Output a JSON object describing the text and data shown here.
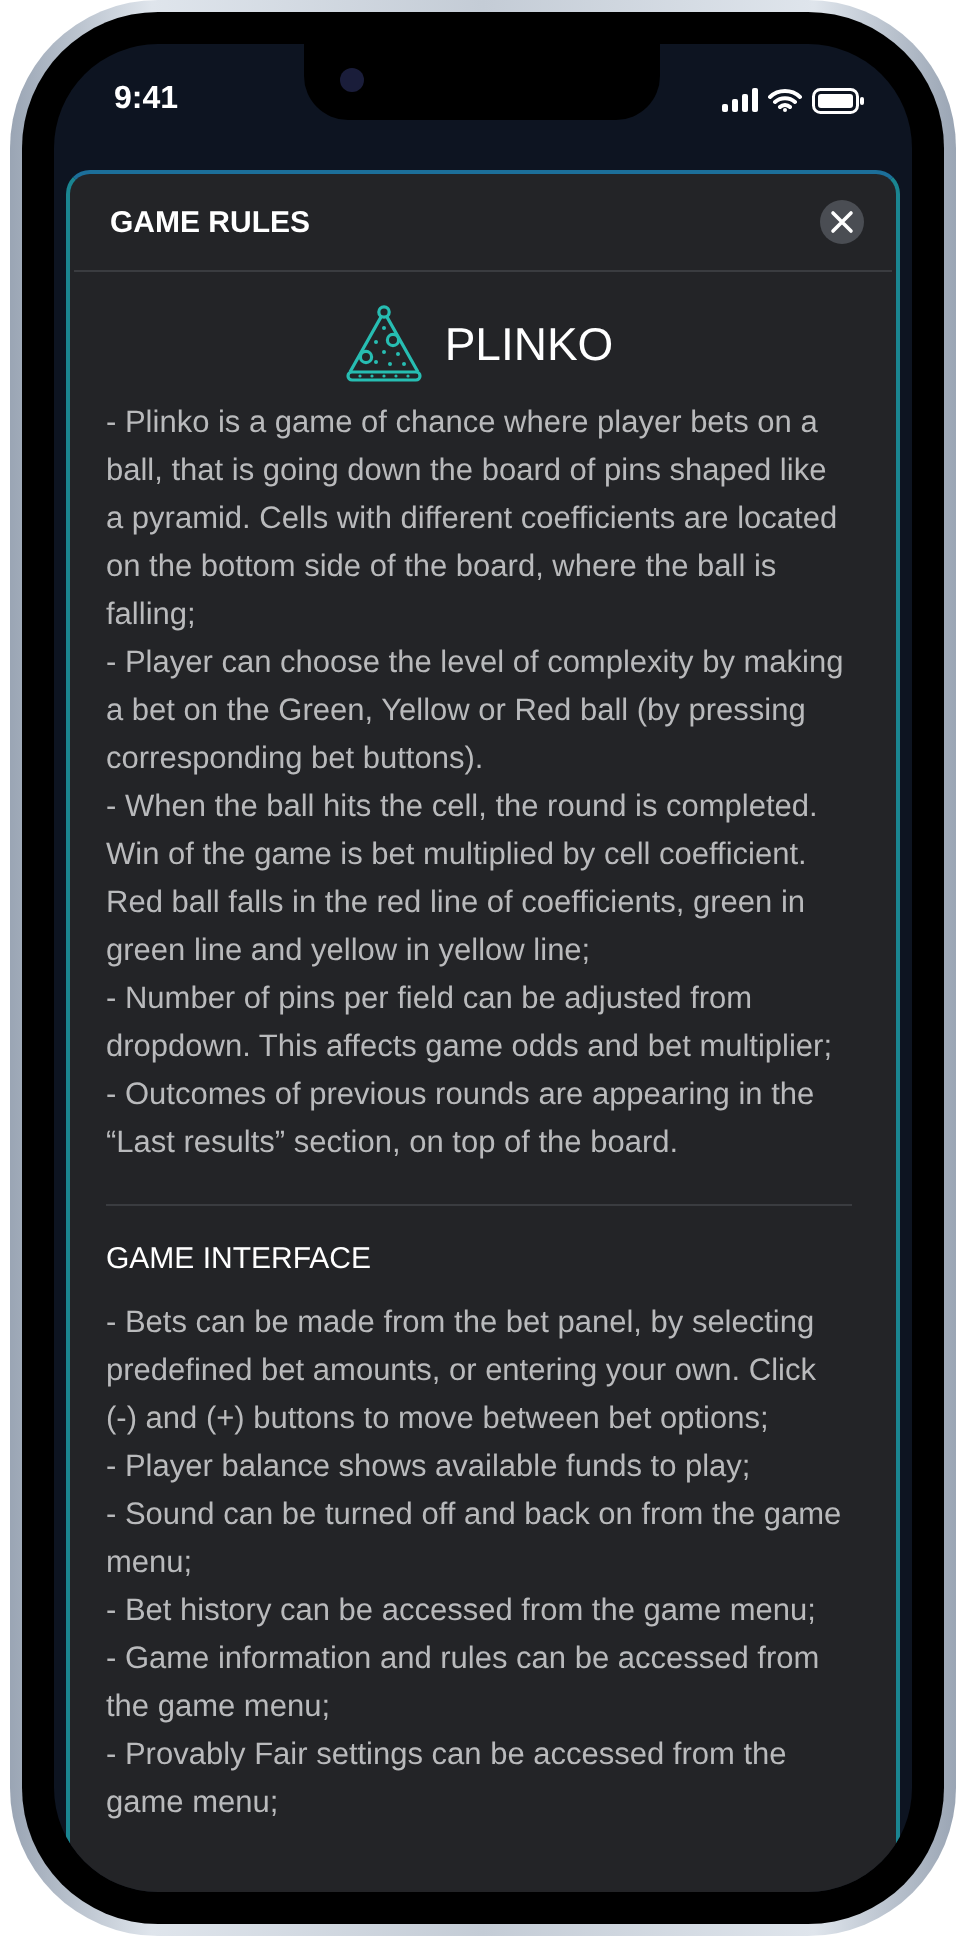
{
  "status_bar": {
    "time": "9:41"
  },
  "modal": {
    "title": "GAME RULES",
    "game_name": "PLINKO",
    "rules": [
      "- Plinko is a game of chance where player bets on a ball, that is going down the board of pins shaped like a pyramid. Cells with different coefficients are located on the bottom side of the board, where the ball is falling;",
      "- Player can choose the level of complexity by making a bet on the Green, Yellow or Red ball (by pressing corresponding bet buttons).",
      "- When the ball hits the cell, the round is completed. Win of the game is bet multiplied by cell coefficient. Red ball falls in the red line of coefficients, green in green line and yellow in yellow line;",
      "- Number of pins per field can be adjusted from dropdown. This affects game odds and bet multiplier;",
      "- Outcomes of previous rounds are appearing in the “Last results” section, on top of the board."
    ],
    "interface_title": "GAME INTERFACE",
    "interface": [
      "- Bets can be made from the bet panel, by selecting predefined bet amounts, or entering your own. Click (-) and (+) buttons to move between bet options;",
      "- Player balance shows available funds to play;",
      "- Sound can be turned off and back on from the game menu;",
      "- Bet history can be accessed from the game menu;",
      "- Game information and rules can be accessed from the game menu;",
      "- Provably Fair settings can be accessed from the game menu;"
    ]
  }
}
